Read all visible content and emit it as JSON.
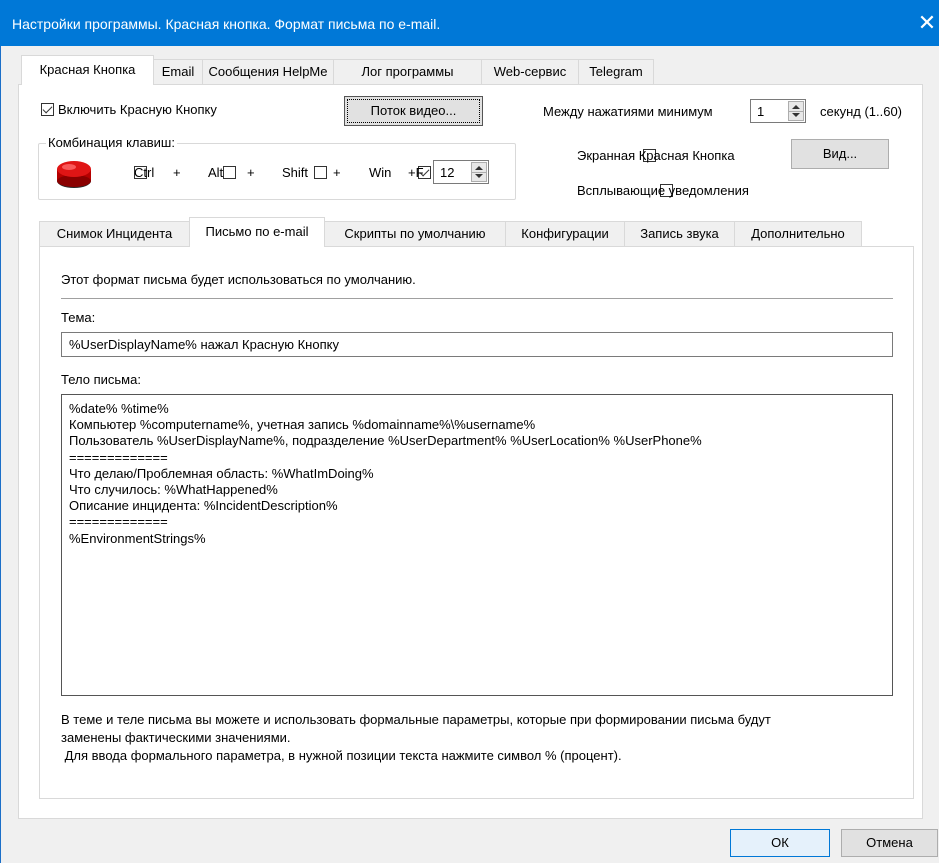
{
  "window": {
    "title": "Настройки программы. Красная кнопка. Формат письма по e-mail.",
    "close_glyph": "✕"
  },
  "top_tabs": [
    {
      "label": "Красная Кнопка",
      "active": true
    },
    {
      "label": "Email"
    },
    {
      "label": "Сообщения HelpMe"
    },
    {
      "label": "Лог программы"
    },
    {
      "label": "Web-сервис"
    },
    {
      "label": "Telegram"
    }
  ],
  "red_button_settings": {
    "enable_label": "Включить Красную Кнопку",
    "enable_checked": true,
    "video_button": "Поток видео...",
    "min_interval_label": "Между нажатиями минимум",
    "min_interval_value": "1",
    "seconds_label": "секунд (1..60)",
    "screen_button_label": "Экранная Красная Кнопка",
    "screen_button_checked": false,
    "view_button": "Вид...",
    "popup_label": "Всплывающие уведомления",
    "popup_checked": false,
    "hotkey": {
      "group_label": "Комбинация клавиш:",
      "ctrl_label": "Ctrl",
      "ctrl_checked": false,
      "plus1": "+",
      "alt_label": "Alt",
      "alt_checked": false,
      "plus2": "+",
      "shift_label": "Shift",
      "shift_checked": false,
      "plus3": "+",
      "win_label": "Win",
      "win_checked": true,
      "plus_f": "+F",
      "f_value": "12"
    }
  },
  "inner_tabs": [
    {
      "label": "Снимок Инцидента"
    },
    {
      "label": "Письмо по e-mail",
      "active": true
    },
    {
      "label": "Скрипты по умолчанию"
    },
    {
      "label": "Конфигурации"
    },
    {
      "label": "Запись звука"
    },
    {
      "label": "Дополнительно"
    }
  ],
  "email_format": {
    "default_note": "Этот формат письма будет использоваться по умолчанию.",
    "subject_label": "Тема:",
    "subject_value": "%UserDisplayName% нажал Красную Кнопку",
    "body_label": "Тело письма:",
    "body_lines": [
      "%date% %time%",
      "Компьютер %computername%, учетная запись %domainname%\\%username%",
      "Пользователь %UserDisplayName%, подразделение %UserDepartment% %UserLocation% %UserPhone%",
      "=============",
      "Что делаю/Проблемная область: %WhatImDoing%",
      "Что случилось: %WhatHappened%",
      "Описание инцидента: %IncidentDescription%",
      "=============",
      "%EnvironmentStrings%"
    ],
    "hint_line1": "В теме и теле письма вы можете и использовать формальные параметры, которые при формировании письма будут",
    "hint_line2": "заменены фактическими значениями.",
    "hint_line3": " Для ввода формального параметра, в нужной позиции текста нажмите символ % (процент)."
  },
  "footer": {
    "ok": "ОК",
    "cancel": "Отмена"
  },
  "colors": {
    "titlebar": "#0078d7",
    "accent": "#0078d7"
  }
}
